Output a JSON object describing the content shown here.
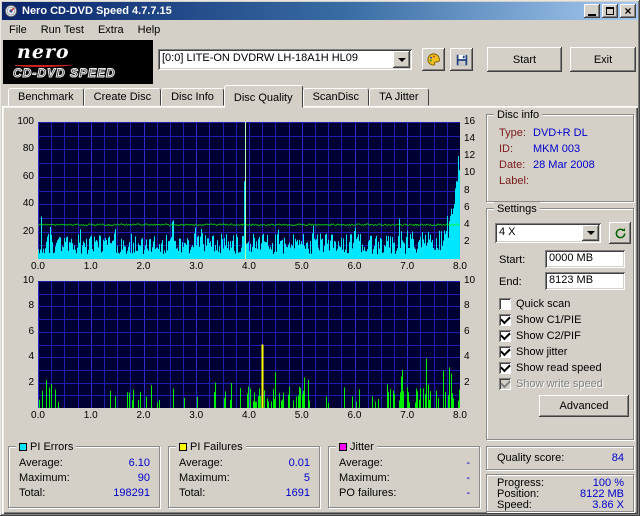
{
  "window": {
    "title": "Nero CD-DVD Speed 4.7.7.15"
  },
  "menu": {
    "items": [
      "File",
      "Run Test",
      "Extra",
      "Help"
    ]
  },
  "toolbar": {
    "logo_line1": "nero",
    "logo_line2": "CD-DVD SPEED",
    "drive_combo": "[0:0]  LITE-ON DVDRW LH-18A1H HL09",
    "start_label": "Start",
    "exit_label": "Exit"
  },
  "tabs": {
    "items": [
      "Benchmark",
      "Create Disc",
      "Disc Info",
      "Disc Quality",
      "ScanDisc",
      "TA Jitter"
    ],
    "active": "Disc Quality"
  },
  "disc_info": {
    "title": "Disc info",
    "rows": [
      {
        "label": "Type:",
        "value": "DVD+R DL"
      },
      {
        "label": "ID:",
        "value": "MKM 003"
      },
      {
        "label": "Date:",
        "value": "28 Mar 2008"
      },
      {
        "label": "Label:",
        "value": ""
      }
    ]
  },
  "settings": {
    "title": "Settings",
    "speed": "4 X",
    "start_label": "Start:",
    "start_value": "0000 MB",
    "end_label": "End:",
    "end_value": "8123 MB",
    "checkboxes": [
      {
        "label": "Quick scan",
        "checked": false,
        "disabled": false
      },
      {
        "label": "Show C1/PIE",
        "checked": true,
        "disabled": false
      },
      {
        "label": "Show C2/PIF",
        "checked": true,
        "disabled": false
      },
      {
        "label": "Show jitter",
        "checked": true,
        "disabled": false
      },
      {
        "label": "Show read speed",
        "checked": true,
        "disabled": false
      },
      {
        "label": "Show write speed",
        "checked": true,
        "disabled": true
      }
    ],
    "advanced_label": "Advanced"
  },
  "quality": {
    "label": "Quality score:",
    "value": "84"
  },
  "progress": {
    "rows": [
      {
        "label": "Progress:",
        "value": "100 %"
      },
      {
        "label": "Position:",
        "value": "8122 MB"
      },
      {
        "label": "Speed:",
        "value": "3.86 X"
      }
    ]
  },
  "legends": [
    {
      "title": "PI Errors",
      "color": "#00e6ff",
      "rows": [
        {
          "label": "Average:",
          "value": "6.10"
        },
        {
          "label": "Maximum:",
          "value": "90"
        },
        {
          "label": "Total:",
          "value": "198291"
        }
      ]
    },
    {
      "title": "PI Failures",
      "color": "#ffff00",
      "rows": [
        {
          "label": "Average:",
          "value": "0.01"
        },
        {
          "label": "Maximum:",
          "value": "5"
        },
        {
          "label": "Total:",
          "value": "1691"
        }
      ]
    },
    {
      "title": "Jitter",
      "color": "#ff00ff",
      "rows": [
        {
          "label": "Average:",
          "value": "-"
        },
        {
          "label": "Maximum:",
          "value": "-"
        },
        {
          "label": "PO failures:",
          "value": "-"
        }
      ]
    }
  ],
  "chart_data": [
    {
      "type": "area",
      "name": "PI Errors scan",
      "x_ticks": [
        "0.0",
        "1.0",
        "2.0",
        "3.0",
        "4.0",
        "5.0",
        "6.0",
        "7.0",
        "8.0"
      ],
      "x_range": [
        0,
        8
      ],
      "left_ticks": [
        100,
        80,
        60,
        40,
        20
      ],
      "left_range": [
        0,
        100
      ],
      "right_ticks": [
        16,
        14,
        12,
        10,
        8,
        6,
        4,
        2
      ],
      "right_range": [
        0,
        16
      ],
      "grid": true,
      "background": "#000033",
      "series": [
        {
          "name": "PI Errors",
          "color": "#00e6ff",
          "average": 6.1,
          "maximum": 90,
          "total": 198291
        },
        {
          "name": "Read speed",
          "color": "#00ff00",
          "speed_x": 4
        }
      ],
      "layer_break_x": 3.92,
      "end_ramp": {
        "start_x": 7.65,
        "peak": 85
      },
      "notable_spikes": [
        [
          0.05,
          34
        ],
        [
          1.45,
          22
        ],
        [
          2.55,
          30
        ],
        [
          3.1,
          22
        ],
        [
          4.55,
          25
        ],
        [
          5.2,
          20
        ],
        [
          6.0,
          26
        ],
        [
          6.85,
          30
        ]
      ]
    },
    {
      "type": "bar",
      "name": "PI Failures scan",
      "x_ticks": [
        "0.0",
        "1.0",
        "2.0",
        "3.0",
        "4.0",
        "5.0",
        "6.0",
        "7.0",
        "8.0"
      ],
      "x_range": [
        0,
        8
      ],
      "left_ticks": [
        10,
        8,
        6,
        4,
        2
      ],
      "left_range": [
        0,
        10
      ],
      "right_ticks": [
        10,
        8,
        6,
        4,
        2
      ],
      "right_range": [
        0,
        10
      ],
      "grid": true,
      "background": "#000033",
      "series": [
        {
          "name": "PI Failures",
          "color": "#00ee00",
          "average": 0.01,
          "maximum": 5,
          "total": 1691
        },
        {
          "name": "Max PIF spike",
          "color": "#ffff00",
          "x": 4.25,
          "value": 5
        }
      ],
      "green_spikes": [
        [
          0.16,
          2.2
        ],
        [
          2.15,
          1.8
        ],
        [
          3.35,
          2.0
        ],
        [
          4.5,
          2.8
        ],
        [
          5.05,
          2.4
        ],
        [
          6.9,
          3.0
        ],
        [
          7.35,
          3.9
        ],
        [
          7.8,
          3.2
        ]
      ]
    }
  ]
}
